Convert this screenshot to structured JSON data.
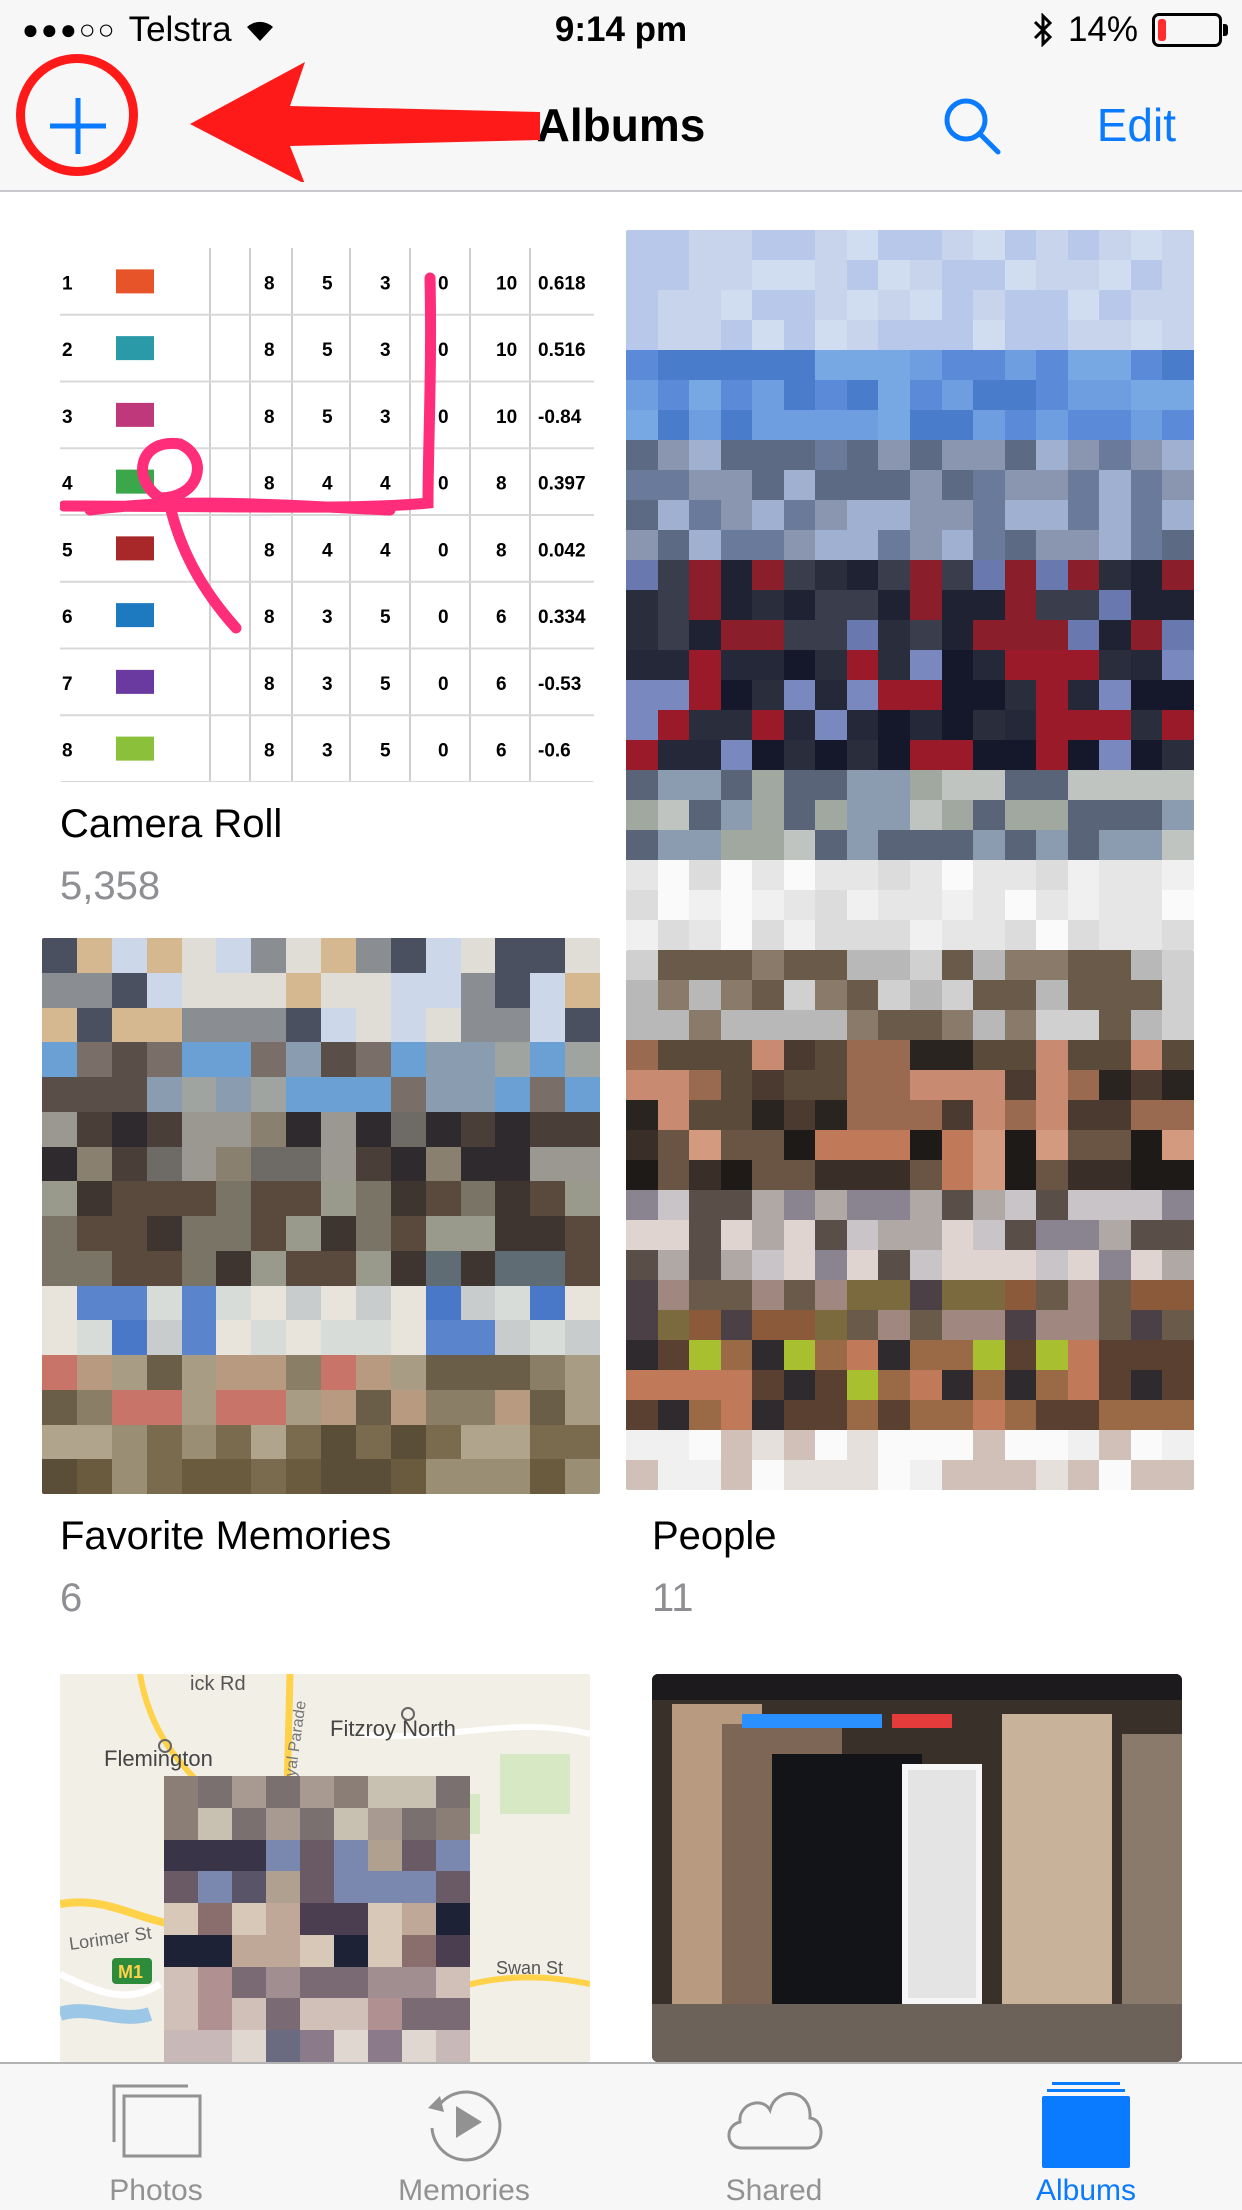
{
  "status_bar": {
    "carrier": "Telstra",
    "time": "9:14 pm",
    "battery": "14%",
    "battery_level": 0.14
  },
  "nav": {
    "title": "Albums",
    "edit_label": "Edit"
  },
  "albums": [
    {
      "title": "Camera Roll",
      "count": "5,358"
    },
    {
      "title": "Favorite Memories",
      "count": "6"
    },
    {
      "title": "People",
      "count": "11"
    }
  ],
  "camera_roll_table": [
    {
      "rank": "1",
      "logo_color": "#e8542a",
      "p": "8",
      "w": "5",
      "l": "3",
      "nr": "0",
      "pts": "10",
      "nrr": "0.618"
    },
    {
      "rank": "2",
      "logo_color": "#2a9aa8",
      "p": "8",
      "w": "5",
      "l": "3",
      "nr": "0",
      "pts": "10",
      "nrr": "0.516"
    },
    {
      "rank": "3",
      "logo_color": "#c0387c",
      "p": "8",
      "w": "5",
      "l": "3",
      "nr": "0",
      "pts": "10",
      "nrr": "-0.84"
    },
    {
      "rank": "4",
      "logo_color": "#3aa84a",
      "p": "8",
      "w": "4",
      "l": "4",
      "nr": "0",
      "pts": "8",
      "nrr": "0.397"
    },
    {
      "rank": "5",
      "logo_color": "#a8282a",
      "p": "8",
      "w": "4",
      "l": "4",
      "nr": "0",
      "pts": "8",
      "nrr": "0.042"
    },
    {
      "rank": "6",
      "logo_color": "#1e7ac0",
      "p": "8",
      "w": "3",
      "l": "5",
      "nr": "0",
      "pts": "6",
      "nrr": "0.334"
    },
    {
      "rank": "7",
      "logo_color": "#6a3aa0",
      "p": "8",
      "w": "3",
      "l": "5",
      "nr": "0",
      "pts": "6",
      "nrr": "-0.53"
    },
    {
      "rank": "8",
      "logo_color": "#8ac03a",
      "p": "8",
      "w": "3",
      "l": "5",
      "nr": "0",
      "pts": "6",
      "nrr": "-0.6"
    }
  ],
  "map_labels": {
    "road_top": "ick Rd",
    "suburb_1": "Flemington",
    "suburb_2": "Fitzroy North",
    "road_side": "oyal Parade",
    "road_left": "Lorimer St",
    "motorway": "M1",
    "road_right": "Swan St"
  },
  "tabs": [
    {
      "label": "Photos",
      "icon": "photos-stack-icon",
      "active": false
    },
    {
      "label": "Memories",
      "icon": "memories-play-icon",
      "active": false
    },
    {
      "label": "Shared",
      "icon": "cloud-icon",
      "active": false
    },
    {
      "label": "Albums",
      "icon": "albums-folder-icon",
      "active": true
    }
  ],
  "colors": {
    "accent": "#0a7aff",
    "annotation": "#ff1a1a",
    "highlighter": "#ff2d7a",
    "battery_low": "#ff2d2d"
  }
}
